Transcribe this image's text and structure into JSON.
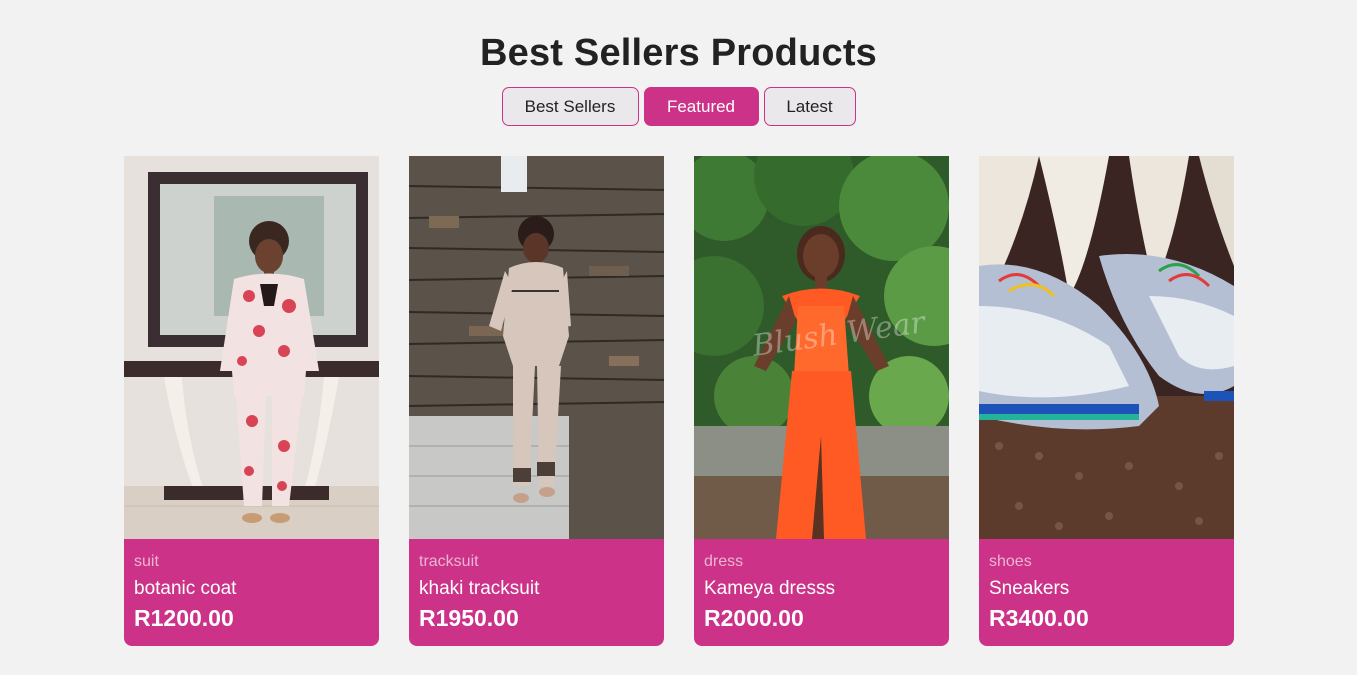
{
  "section": {
    "title": "Best Sellers Products"
  },
  "tabs": [
    {
      "label": "Best Sellers",
      "active": false
    },
    {
      "label": "Featured",
      "active": true
    },
    {
      "label": "Latest",
      "active": false
    }
  ],
  "products": [
    {
      "category": "suit",
      "name": "botanic coat",
      "price": "R1200.00"
    },
    {
      "category": "tracksuit",
      "name": "khaki tracksuit",
      "price": "R1950.00"
    },
    {
      "category": "dress",
      "name": "Kameya dresss",
      "price": "R2000.00"
    },
    {
      "category": "shoes",
      "name": "Sneakers",
      "price": "R3400.00"
    }
  ],
  "colors": {
    "accent": "#cc3388",
    "background": "#f2f2f2",
    "title": "#222222"
  }
}
